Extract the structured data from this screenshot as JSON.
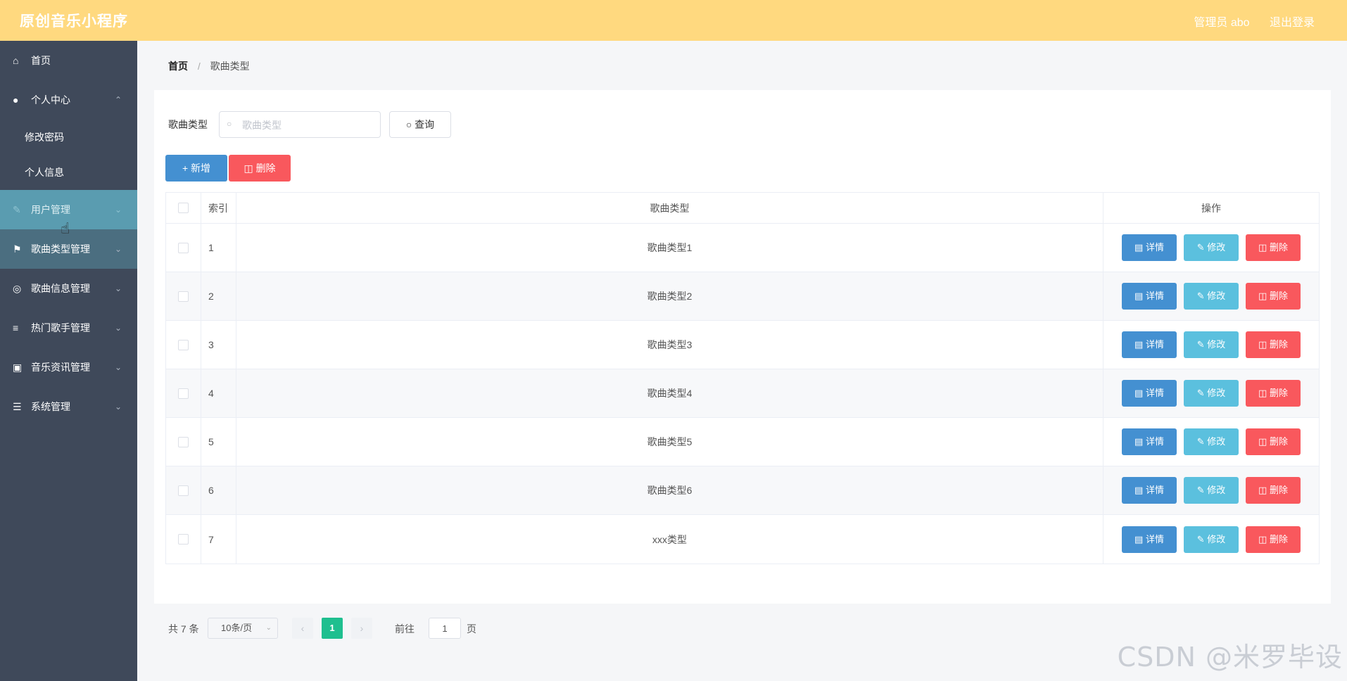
{
  "header": {
    "app_title": "原创音乐小程序",
    "admin_label": "管理员 abo",
    "logout_label": "退出登录"
  },
  "sidebar": {
    "items": [
      {
        "label": "首页",
        "icon": "home-icon"
      },
      {
        "label": "个人中心",
        "icon": "user-icon",
        "expanded": true,
        "children": [
          {
            "label": "修改密码"
          },
          {
            "label": "个人信息"
          }
        ]
      },
      {
        "label": "用户管理",
        "icon": "edit-icon"
      },
      {
        "label": "歌曲类型管理",
        "icon": "flag-icon"
      },
      {
        "label": "歌曲信息管理",
        "icon": "dial-icon"
      },
      {
        "label": "热门歌手管理",
        "icon": "sliders-icon"
      },
      {
        "label": "音乐资讯管理",
        "icon": "wallet-icon"
      },
      {
        "label": "系统管理",
        "icon": "list-icon"
      }
    ]
  },
  "breadcrumb": {
    "home": "首页",
    "current": "歌曲类型"
  },
  "search": {
    "label": "歌曲类型",
    "placeholder": "歌曲类型",
    "query_label": "查询"
  },
  "actions": {
    "add_label": "新增",
    "delete_label": "删除"
  },
  "table": {
    "headers": {
      "index": "索引",
      "name": "歌曲类型",
      "ops": "操作"
    },
    "op_labels": {
      "detail": "详情",
      "edit": "修改",
      "delete": "删除"
    },
    "rows": [
      {
        "index": "1",
        "name": "歌曲类型1"
      },
      {
        "index": "2",
        "name": "歌曲类型2"
      },
      {
        "index": "3",
        "name": "歌曲类型3"
      },
      {
        "index": "4",
        "name": "歌曲类型4"
      },
      {
        "index": "5",
        "name": "歌曲类型5"
      },
      {
        "index": "6",
        "name": "歌曲类型6"
      },
      {
        "index": "7",
        "name": "xxx类型"
      }
    ]
  },
  "pagination": {
    "total_text": "共 7 条",
    "page_size": "10条/页",
    "current_page": "1",
    "goto_label": "前往",
    "goto_value": "1",
    "page_unit": "页"
  },
  "watermark": "CSDN @米罗毕设",
  "colors": {
    "header": "#ffd97f",
    "sidebar": "#3f495a",
    "primary": "#4490d1",
    "danger": "#f9585d",
    "info": "#5bc0de",
    "pager_active": "#1fbf8f"
  }
}
